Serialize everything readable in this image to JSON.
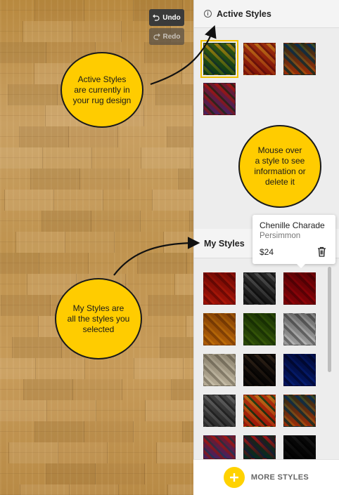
{
  "toolbar": {
    "undo_label": "Undo",
    "redo_label": "Redo"
  },
  "active_styles": {
    "title": "Active Styles",
    "info_icon": "i",
    "swatches": [
      {
        "name": "active-style-1",
        "colors": [
          "#3d7a4a",
          "#c9b23a",
          "#2f5a8c"
        ],
        "selected": true
      },
      {
        "name": "active-style-2",
        "colors": [
          "#b5462e",
          "#d9a64a",
          "#8a2a2a"
        ],
        "selected": false
      },
      {
        "name": "active-style-3",
        "colors": [
          "#c76a2a",
          "#3a6a8a",
          "#d9b04a"
        ],
        "selected": false
      },
      {
        "name": "active-style-4",
        "colors": [
          "#8a5a9a",
          "#c84a4a",
          "#4a6a3a"
        ],
        "selected": false
      }
    ]
  },
  "my_styles": {
    "title": "My Styles",
    "swatches": [
      {
        "colors": [
          "#c8432a",
          "#9a2a1a",
          "#e0603a"
        ]
      },
      {
        "colors": [
          "#4a4a4a",
          "#8a8a8a",
          "#2a2a2a"
        ]
      },
      {
        "colors": [
          "#b3182a",
          "#8a1020",
          "#d0283a"
        ]
      },
      {
        "colors": [
          "#d39a2a",
          "#a8741a",
          "#e8b83a"
        ]
      },
      {
        "colors": [
          "#6a8a2a",
          "#4a6a1a",
          "#8aa83a"
        ]
      },
      {
        "colors": [
          "#c8c8c8",
          "#8a8a8a",
          "#eaeaea"
        ]
      },
      {
        "colors": [
          "#d8d2c4",
          "#a8a294",
          "#ece8dc"
        ]
      },
      {
        "colors": [
          "#2a2420",
          "#6a5a4a",
          "#140f0c"
        ]
      },
      {
        "colors": [
          "#1a4a9a",
          "#0a2a6a",
          "#3a6ac0"
        ]
      },
      {
        "colors": [
          "#6a6a6a",
          "#9a9a9a",
          "#444444"
        ]
      },
      {
        "colors": [
          "#c84a2a",
          "#d9a64a",
          "#2a6a4a"
        ]
      },
      {
        "colors": [
          "#c76a2a",
          "#3a6a8a",
          "#d9b04a"
        ]
      },
      {
        "colors": [
          "#8a5a9a",
          "#c84a4a",
          "#4a8a9a"
        ]
      },
      {
        "colors": [
          "#2a6a5a",
          "#c84a4a",
          "#3a4a8a"
        ]
      },
      {
        "colors": [
          "#1a1a1a",
          "#4a4a4a",
          "#0a0a0a"
        ]
      }
    ]
  },
  "tooltip": {
    "style_name": "Chenille Charade",
    "color_name": "Persimmon",
    "price": "$24"
  },
  "footer": {
    "more_styles_label": "MORE STYLES"
  },
  "annotations": {
    "active_styles_note": [
      "Active Styles",
      "are currently in",
      "your rug design"
    ],
    "mouse_over_note": [
      "Mouse over",
      "a style to see",
      "information or",
      "delete it"
    ],
    "my_styles_note": [
      "My Styles are",
      "all the styles you",
      "selected"
    ]
  },
  "colors": {
    "accent_yellow": "#ffcc00",
    "selected_outline": "#f2c200",
    "panel_bg": "#ededed"
  }
}
